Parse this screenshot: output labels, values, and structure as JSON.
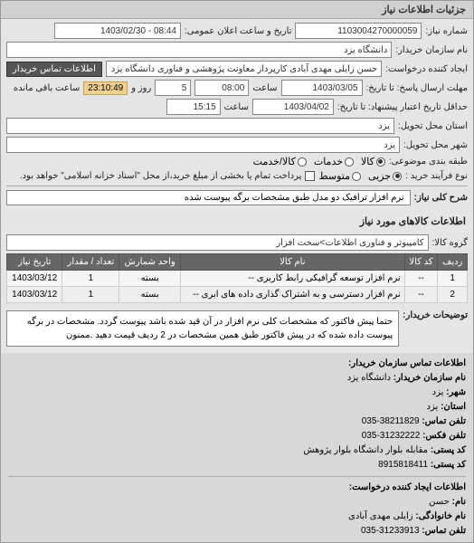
{
  "header": {
    "title": "جزئیات اطلاعات نیاز"
  },
  "form": {
    "request_number_label": "شماره نیاز:",
    "request_number": "1103004270000059",
    "public_datetime_label": "تاریخ و ساعت اعلان عمومی:",
    "public_datetime": "08:44 - 1403/02/30",
    "buyer_name_label": "نام سازمان خریدار:",
    "buyer_name": "دانشگاه یزد",
    "creator_label": "ایجاد کننده درخواست:",
    "creator": "حسن زایلی مهدی آبادی کارپرداز معاونت پژوهشی و فناوری دانشگاه یزد",
    "contact_link": "اطلاعات تماس خریدار",
    "deadline_label": "مهلت ارسال پاسخ: تا تاریخ:",
    "deadline_date": "1403/03/05",
    "time_label": "ساعت",
    "deadline_time": "08:00",
    "days_label": "روز و",
    "days": "5",
    "remaining_label": "ساعت باقی مانده",
    "remaining_time": "23:10:49",
    "delivery_deadline_label": "حداقل تاریخ اعتبار پیشنهاد: تا تاریخ:",
    "delivery_date": "1403/04/02",
    "delivery_time": "15:15",
    "state_label": "استان محل تحویل:",
    "state": "یزد",
    "city_label": "شهر محل تحویل:",
    "city": "یزد",
    "classification_label": "طبقه بندی موضوعی:",
    "radio_kala": "کالا",
    "radio_khadamat": "خدمات",
    "radio_kala_khadamat": "کالا/خدمت",
    "process_label": "نوع فرآیند خرید :",
    "radio_jozi": "جزیی",
    "radio_motavasset": "متوسط",
    "process_note": "پرداخت تمام یا بخشی از مبلغ خرید،از محل \"اسناد خزانه اسلامی\" خواهد بود.",
    "summary_label": "شرح کلی نیاز:",
    "summary": "نرم افزار ترافیک دو مدل طبق مشخصات برگه پیوست شده"
  },
  "goods": {
    "header": "اطلاعات کالاهای مورد نیاز",
    "group_label": "گروه کالا:",
    "group": "کامپیوتر و فناوری اطلاعات>سخت افزار",
    "columns": [
      "ردیف",
      "کد کالا",
      "نام کالا",
      "واحد شمارش",
      "تعداد / مقدار",
      "تاریخ نیاز"
    ],
    "rows": [
      {
        "idx": "1",
        "code": "--",
        "name": "نرم افزار توسعه گرافیکی رابط کاربری --",
        "unit": "بسته",
        "qty": "1",
        "date": "1403/03/12"
      },
      {
        "idx": "2",
        "code": "--",
        "name": "نرم افزار دسترسی و به اشتراک گذاری داده های ابری --",
        "unit": "بسته",
        "qty": "1",
        "date": "1403/03/12"
      }
    ]
  },
  "notes": {
    "label": "توضیحات خریدار:",
    "text": "حتما پیش فاکتور که مشخصات کلی نرم افزار در آن قید شده باشد پیوست گردد. مشخصات در برگه پیوست داده شده که در پیش فاکتور طبق همین مشخصات در 2 ردیف قیمت دهید .ممنون"
  },
  "contact_buyer": {
    "header": "اطلاعات تماس سازمان خریدار:",
    "org_label": "نام سازمان خریدار:",
    "org": "دانشگاه یزد",
    "city_label": "شهر:",
    "city": "یزد",
    "state_label": "استان:",
    "state": "یزد",
    "phone_label": "تلفن تماس:",
    "phone": "38211829-035",
    "fax_label": "تلفن فکس:",
    "fax": "31232222-035",
    "postal_label": "کد پستی:",
    "postal": "مقابله بلوار دانشگاه بلوار پژوهش",
    "postal2_label": "کد پستی:",
    "postal2": "8915818411"
  },
  "contact_creator": {
    "header": "اطلاعات ایجاد کننده درخواست:",
    "name_label": "نام:",
    "name": "حسن",
    "family_label": "نام خانوادگی:",
    "family": "زایلی مهدی آبادی",
    "phone_label": "تلفن تماس:",
    "phone": "31233913-035"
  }
}
